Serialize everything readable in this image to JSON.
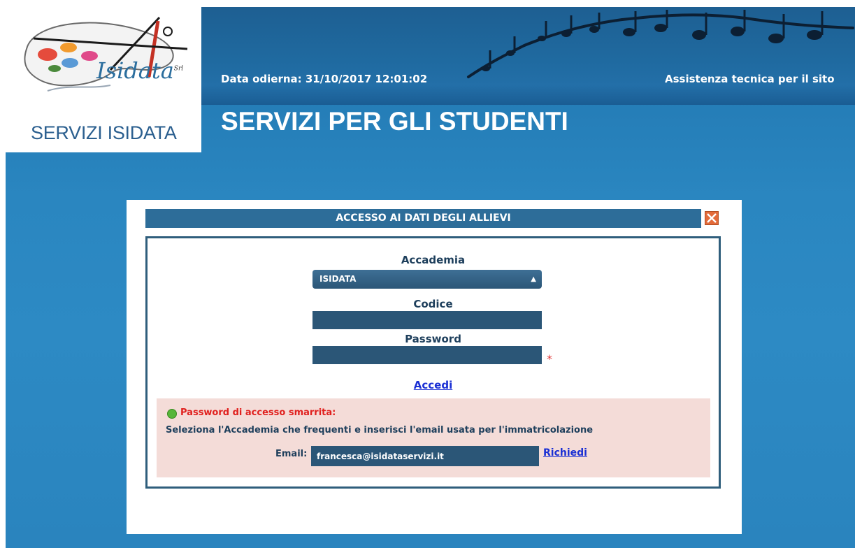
{
  "header": {
    "date_label": "Data odierna: 31/10/2017 12:01:02",
    "assistance_link": "Assistenza tecnica per il sito",
    "page_title": "SERVIZI PER GLI STUDENTI"
  },
  "logo": {
    "brand_word": "Isidata",
    "brand_suffix": "Srl",
    "caption": "SERVIZI ISIDATA"
  },
  "dialog": {
    "title": "ACCESSO AI DATI DEGLI ALLIEVI",
    "close_icon": "close-icon",
    "academy_label": "Accademia",
    "academy_selected": "ISIDATA",
    "code_label": "Codice",
    "code_value": "",
    "password_label": "Password",
    "password_value": "",
    "required_marker": "*",
    "login_link": "Accedi",
    "recovery": {
      "title": "Password di accesso smarrita:",
      "instructions": "Seleziona l'Accademia che frequenti e inserisci l'email usata per l'immatricolazione",
      "email_label": "Email:",
      "email_value": "francesca@isidataservizi.it",
      "request_link": "Richiedi"
    }
  },
  "colors": {
    "background_blue": "#2a86c0",
    "field_dark": "#2b5677",
    "link_blue": "#1a2fd4",
    "alert_red": "#e0201e",
    "recovery_bg": "#f4dcd8",
    "logo_text": "#2b5f8f"
  }
}
